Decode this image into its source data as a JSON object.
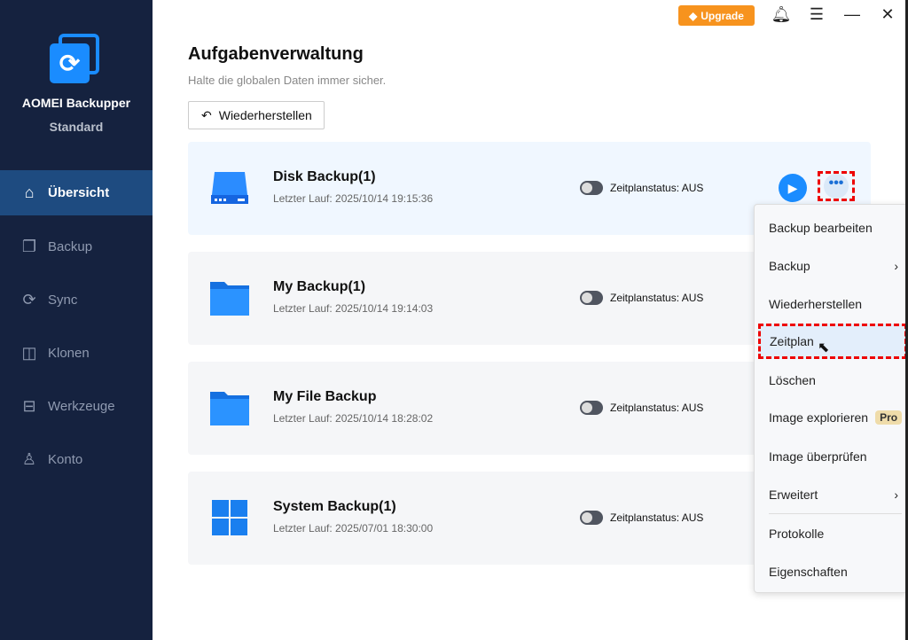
{
  "app": {
    "name": "AOMEI Backupper",
    "edition": "Standard"
  },
  "sidebar": {
    "items": [
      {
        "label": "Übersicht",
        "icon": "home-icon"
      },
      {
        "label": "Backup",
        "icon": "backup-icon"
      },
      {
        "label": "Sync",
        "icon": "sync-icon"
      },
      {
        "label": "Klonen",
        "icon": "clone-icon"
      },
      {
        "label": "Werkzeuge",
        "icon": "toolbox-icon"
      },
      {
        "label": "Konto",
        "icon": "user-icon"
      }
    ]
  },
  "topbar": {
    "upgrade": "Upgrade"
  },
  "main": {
    "title": "Aufgabenverwaltung",
    "subtitle": "Halte die globalen Daten immer sicher.",
    "restore_button": "Wiederherstellen",
    "tasks": [
      {
        "title": "Disk Backup(1)",
        "last_run": "Letzter Lauf: 2025/10/14 19:15:36",
        "status": "Zeitplanstatus: AUS",
        "icon": "disk-icon"
      },
      {
        "title": "My Backup(1)",
        "last_run": "Letzter Lauf: 2025/10/14 19:14:03",
        "status": "Zeitplanstatus: AUS",
        "icon": "folder-icon"
      },
      {
        "title": "My File Backup",
        "last_run": "Letzter Lauf: 2025/10/14 18:28:02",
        "status": "Zeitplanstatus: AUS",
        "icon": "folder-icon"
      },
      {
        "title": "System Backup(1)",
        "last_run": "Letzter Lauf: 2025/07/01 18:30:00",
        "status": "Zeitplanstatus: AUS",
        "icon": "windows-icon"
      }
    ]
  },
  "context_menu": {
    "items": [
      "Backup bearbeiten",
      "Backup",
      "Wiederherstellen",
      "Zeitplan",
      "Löschen",
      "Image explorieren",
      "Image überprüfen",
      "Erweitert",
      "Protokolle",
      "Eigenschaften"
    ],
    "pro_badge": "Pro"
  }
}
